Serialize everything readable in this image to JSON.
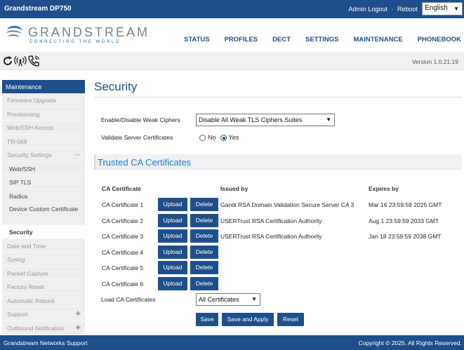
{
  "topbar": {
    "model": "Grandstream DP750",
    "admin_logout": "Admin Logout",
    "separator": "·",
    "reboot": "Reboot",
    "language": "English"
  },
  "header": {
    "logo_name": "GRANDSTREAM",
    "logo_tagline": "CONNECTING THE WORLD",
    "nav": [
      "STATUS",
      "PROFILES",
      "DECT",
      "SETTINGS",
      "MAINTENANCE",
      "PHONEBOOK"
    ]
  },
  "toolbar": {
    "icons": [
      "refresh-icon",
      "signal-icon",
      "phone-icon"
    ],
    "version": "Version 1.0.21.19"
  },
  "sidebar": {
    "heading": "Maintenance",
    "items": [
      {
        "label": "Firmware Upgrade",
        "type": "item"
      },
      {
        "label": "Provisioning",
        "type": "item"
      },
      {
        "label": "Web/SSH Access",
        "type": "item"
      },
      {
        "label": "TR-069",
        "type": "item"
      },
      {
        "label": "Security Settings",
        "type": "item",
        "mark": "—"
      },
      {
        "label": "Web/SSH",
        "type": "sub"
      },
      {
        "label": "SIP TLS",
        "type": "sub"
      },
      {
        "label": "Radius",
        "type": "sub"
      },
      {
        "label": "Device Custom Certificate",
        "type": "sub-tall"
      },
      {
        "label": "Security",
        "type": "active"
      },
      {
        "label": "Date and Time",
        "type": "item"
      },
      {
        "label": "Syslog",
        "type": "item"
      },
      {
        "label": "Packet Capture",
        "type": "item"
      },
      {
        "label": "Factory Reset",
        "type": "item"
      },
      {
        "label": "Automatic Reboot",
        "type": "item"
      },
      {
        "label": "Support",
        "type": "item",
        "mark": "✚"
      },
      {
        "label": "Outbound Notification",
        "type": "item",
        "mark": "✚"
      }
    ]
  },
  "main": {
    "title": "Security",
    "weak_ciphers_label": "Enable/Disable Weak Ciphers",
    "weak_ciphers_value": "Disable All Weak TLS Ciphers Suites",
    "validate_label": "Validate Server Certificates",
    "validate_no": "No",
    "validate_yes": "Yes",
    "validate_selected": "Yes",
    "section_title": "Trusted CA Certificates",
    "columns": {
      "cert": "CA Certificate",
      "issued": "Issued by",
      "expires": "Expires by"
    },
    "upload_label": "Upload",
    "delete_label": "Delete",
    "certificates": [
      {
        "name": "CA Certificate 1",
        "issuer": "Gandi RSA Domain Validation Secure Server CA 3",
        "expires": "Mar 16 23:59:59 2025 GMT"
      },
      {
        "name": "CA Certificate 2",
        "issuer": "USERTrust RSA Certification Authority",
        "expires": "Aug 1 23:59:59 2033 GMT"
      },
      {
        "name": "CA Certificate 3",
        "issuer": "USERTrust RSA Certification Authority",
        "expires": "Jan 18 23:59:59 2038 GMT"
      },
      {
        "name": "CA Certificate 4",
        "issuer": "",
        "expires": ""
      },
      {
        "name": "CA Certificate 5",
        "issuer": "",
        "expires": ""
      },
      {
        "name": "CA Certificate 6",
        "issuer": "",
        "expires": ""
      }
    ],
    "load_label": "Load CA Certificates",
    "load_value": "All Certificates",
    "save": "Save",
    "save_apply": "Save and Apply",
    "reset": "Reset"
  },
  "footer": {
    "left": "Grandstream Networks Support",
    "right": "Copyright © 2025. All Rights Reserved."
  },
  "colors": {
    "brand": "#1e4f8a",
    "section_text": "#1e7fc4"
  }
}
